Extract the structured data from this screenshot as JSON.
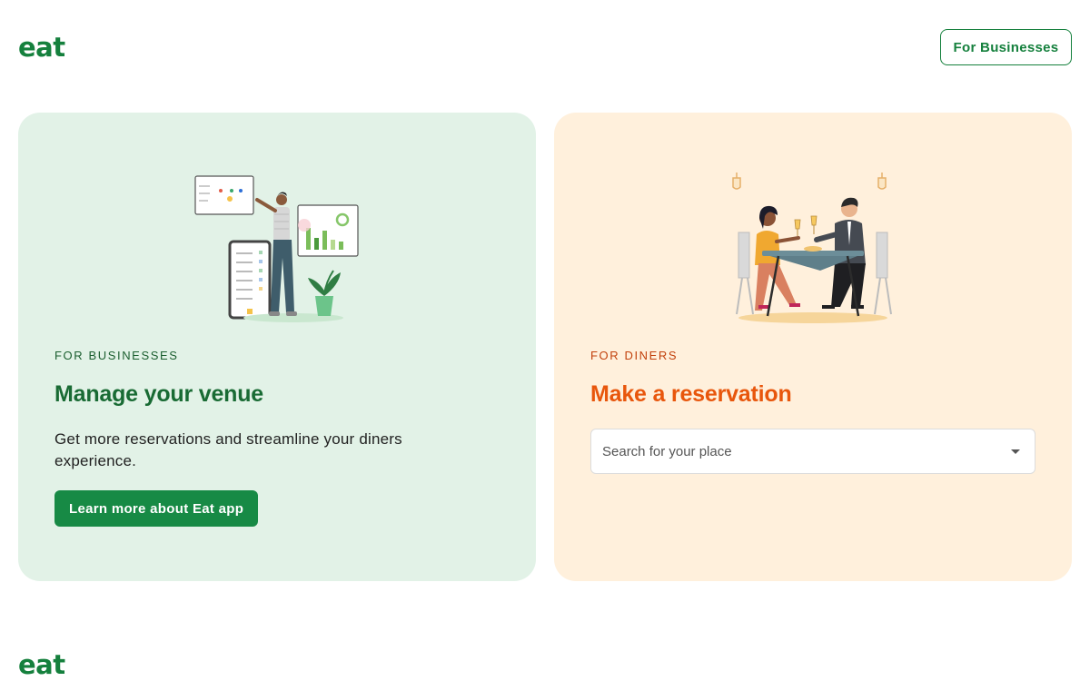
{
  "header": {
    "logo": "eat",
    "for_businesses_button": "For Businesses"
  },
  "business_card": {
    "eyebrow": "FOR BUSINESSES",
    "headline": "Manage your venue",
    "description": "Get more reservations and streamline your diners experience.",
    "cta_label": "Learn more about Eat app",
    "illustration": "business-manager-illustration"
  },
  "diner_card": {
    "eyebrow": "FOR DINERS",
    "headline": "Make a reservation",
    "search": {
      "placeholder": "Search for your place",
      "value": ""
    },
    "illustration": "dining-couple-illustration"
  },
  "footer": {
    "logo": "eat"
  },
  "colors": {
    "brand_green": "#15803d",
    "business_bg": "#e2f2e7",
    "diner_bg": "#fff0dc",
    "diner_accent": "#e8560c"
  }
}
